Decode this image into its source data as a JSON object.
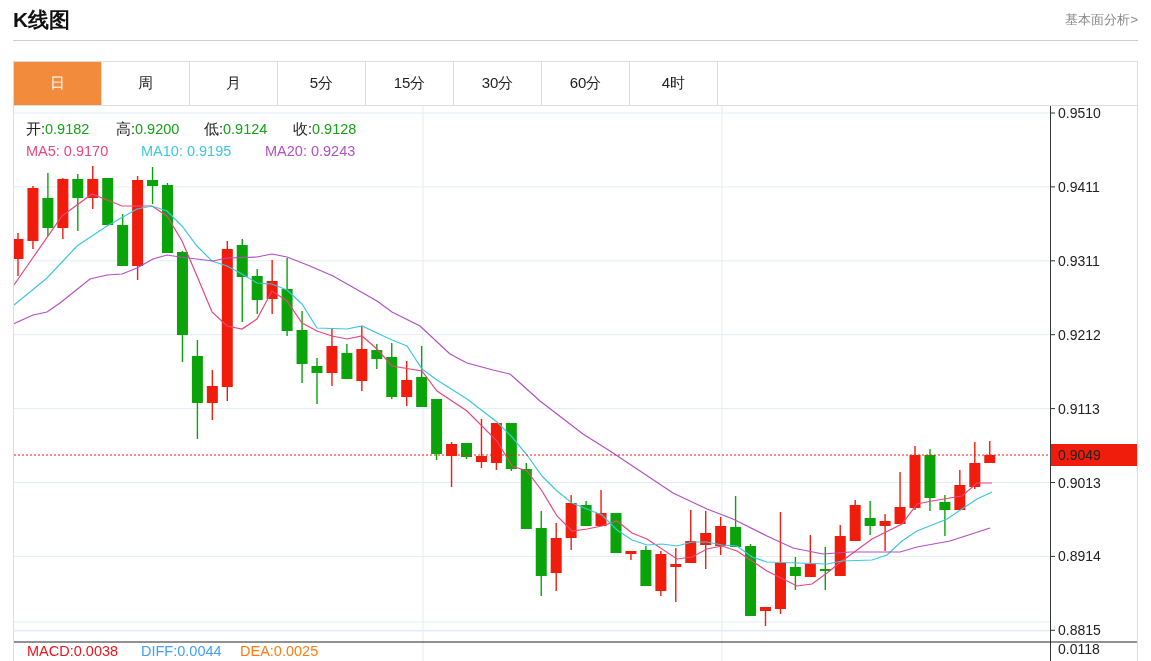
{
  "header": {
    "title": "K线图",
    "link": "基本面分析>"
  },
  "tabs": [
    {
      "label": "日",
      "selected": true
    },
    {
      "label": "周",
      "selected": false
    },
    {
      "label": "月",
      "selected": false
    },
    {
      "label": "5分",
      "selected": false
    },
    {
      "label": "15分",
      "selected": false
    },
    {
      "label": "30分",
      "selected": false
    },
    {
      "label": "60分",
      "selected": false
    },
    {
      "label": "4时",
      "selected": false
    }
  ],
  "ohlc": [
    {
      "label": "开:",
      "value": "0.9182"
    },
    {
      "label": "高:",
      "value": "0.9200"
    },
    {
      "label": "低:",
      "value": "0.9124"
    },
    {
      "label": "收:",
      "value": "0.9128"
    }
  ],
  "moving_averages": [
    {
      "label": "MA5:",
      "value": "0.9170",
      "color": "#e8467c"
    },
    {
      "label": "MA10:",
      "value": "0.9195",
      "color": "#3cc8dc"
    },
    {
      "label": "MA20:",
      "value": "0.9243",
      "color": "#b350c2"
    }
  ],
  "price_axis": [
    "0.9510",
    "0.9411",
    "0.9311",
    "0.9212",
    "0.9113",
    "0.9013",
    "0.8914",
    "0.8815"
  ],
  "current_price": "0.9049",
  "macd_axis_tick": "0.0118",
  "macd": [
    {
      "label": "MACD:",
      "value": "0.0038",
      "color": "#f0141e"
    },
    {
      "label": "DIFF:",
      "value": "0.0044",
      "color": "#44a2f0"
    },
    {
      "label": "DEA:",
      "value": "0.0025",
      "color": "#ff7d14"
    }
  ]
}
